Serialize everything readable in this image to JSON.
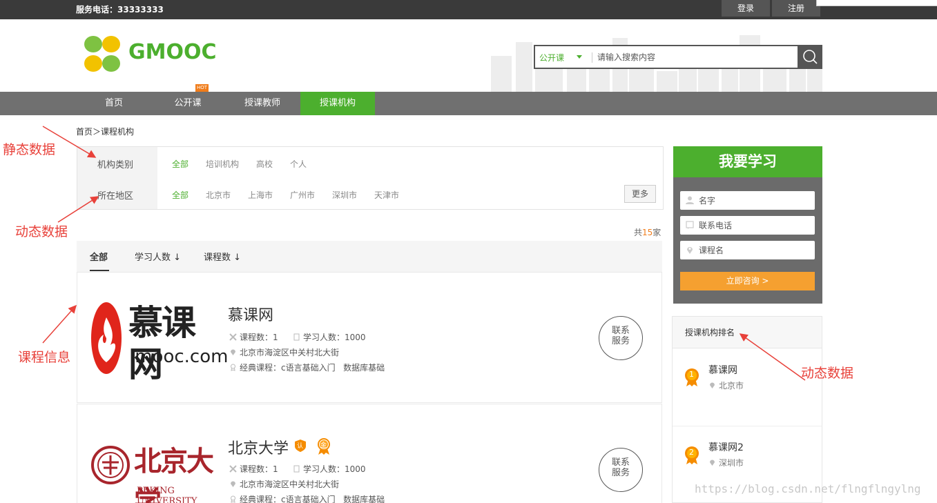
{
  "topbar": {
    "phone": "服务电话：33333333",
    "login": "登录",
    "register": "注册"
  },
  "header": {
    "logo_text": "GMOOC",
    "search": {
      "category": "公开课",
      "placeholder": "请输入搜索内容"
    }
  },
  "nav": {
    "items": [
      "首页",
      "公开课",
      "授课教师",
      "授课机构"
    ],
    "active_index": 3,
    "hot_badge": "HOT"
  },
  "breadcrumb": "首页＞课程机构",
  "filter": {
    "category_label": "机构类别",
    "category_options": [
      "全部",
      "培训机构",
      "高校",
      "个人"
    ],
    "region_label": "所在地区",
    "region_options": [
      "全部",
      "北京市",
      "上海市",
      "广州市",
      "深圳市",
      "天津市"
    ],
    "more": "更多"
  },
  "total": {
    "prefix": "共",
    "count": "15",
    "suffix": "家"
  },
  "sort_tabs": [
    "全部",
    "学习人数 ↓",
    "课程数 ↓"
  ],
  "orgs": [
    {
      "name": "慕课网",
      "logo_text_big": "慕课网",
      "logo_text_small": "imooc.com",
      "courses": "课程数：1",
      "students": "学习人数：1000",
      "address": "北京市海淀区中关村北大街",
      "classic": "经典课程：",
      "classic_courses": [
        "c语言基础入门",
        "数据库基础"
      ],
      "contact": [
        "联系",
        "服务"
      ]
    },
    {
      "name": "北京大学",
      "logo_text_big": "北京大学",
      "logo_text_small": "PEKING UNIVERSITY",
      "badge_cert": "认",
      "badge_gold": "金",
      "courses": "课程数：1",
      "students": "学习人数：1000",
      "address": "北京市海淀区中关村北大街",
      "classic": "经典课程：",
      "classic_courses": [
        "c语言基础入门",
        "数据库基础"
      ],
      "contact": [
        "联系",
        "服务"
      ]
    }
  ],
  "learn": {
    "title": "我要学习",
    "name_placeholder": "名字",
    "phone_placeholder": "联系电话",
    "course_placeholder": "课程名",
    "submit": "立即咨询 >"
  },
  "ranking": {
    "title": "授课机构排名",
    "items": [
      {
        "rank": "1",
        "name": "慕课网",
        "city": "北京市"
      },
      {
        "rank": "2",
        "name": "慕课网2",
        "city": "深圳市"
      }
    ]
  },
  "annotations": {
    "static_data": "静态数据",
    "dynamic_data_left": "动态数据",
    "course_info": "课程信息",
    "dynamic_data_right": "动态数据"
  },
  "watermark": "https://blog.csdn.net/flngflngylng",
  "colors": {
    "brand_green": "#4caf2e",
    "accent_orange": "#f5a030",
    "annotation_red": "#e8413a",
    "nav_gray": "#707070"
  }
}
